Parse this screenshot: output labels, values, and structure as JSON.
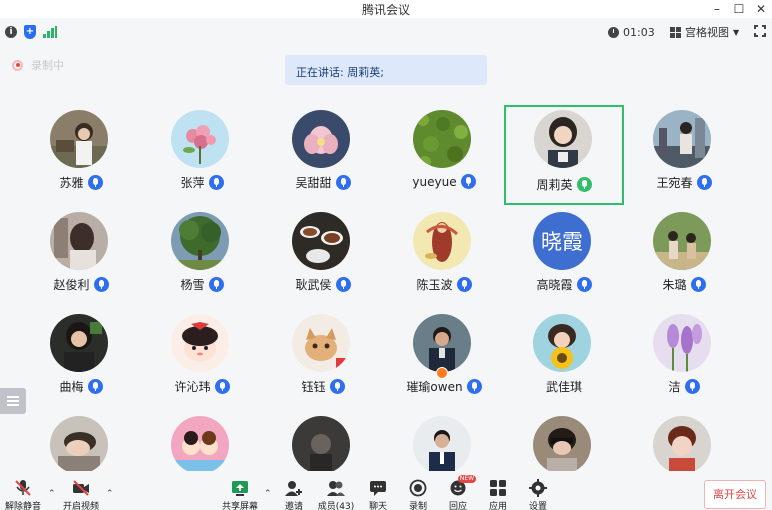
{
  "window": {
    "title": "腾讯会议"
  },
  "status": {
    "timer": "01:03",
    "view_label": "宫格视图"
  },
  "recording": {
    "label": "录制中"
  },
  "speaking": {
    "label": "正在讲话: 周莉英;"
  },
  "participants": [
    {
      "name": "苏雅",
      "mic": "blue"
    },
    {
      "name": "张萍",
      "mic": "blue"
    },
    {
      "name": "吴甜甜",
      "mic": "blue"
    },
    {
      "name": "yueyue",
      "mic": "blue"
    },
    {
      "name": "周莉英",
      "mic": "green",
      "speaking": true
    },
    {
      "name": "王宛春",
      "mic": "blue"
    },
    {
      "name": "赵俊利",
      "mic": "blue"
    },
    {
      "name": "杨雪",
      "mic": "blue"
    },
    {
      "name": "耿武侯",
      "mic": "blue"
    },
    {
      "name": "陈玉波",
      "mic": "blue"
    },
    {
      "name": "高晓霞",
      "mic": "blue",
      "avatar_text": "晓霞"
    },
    {
      "name": "朱璐",
      "mic": "blue"
    },
    {
      "name": "曲梅",
      "mic": "blue"
    },
    {
      "name": "许沁玮",
      "mic": "blue"
    },
    {
      "name": "钰钰",
      "mic": "blue"
    },
    {
      "name": "璀瑜owen",
      "mic": "blue",
      "host": true
    },
    {
      "name": "武佳琪",
      "mic": "none"
    },
    {
      "name": "洁",
      "mic": "blue"
    }
  ],
  "toolbar": {
    "unmute": "解除静音",
    "start_video": "开启视频",
    "share_screen": "共享屏幕",
    "invite": "邀请",
    "members": "成员(43)",
    "chat": "聊天",
    "record": "录制",
    "reactions": "回应",
    "apps": "应用",
    "settings": "设置",
    "new_badge": "NEW",
    "leave": "离开会议"
  },
  "colors": {
    "accent": "#2f6ef0",
    "speaking": "#2fbf6b",
    "leave": "#e04646"
  }
}
